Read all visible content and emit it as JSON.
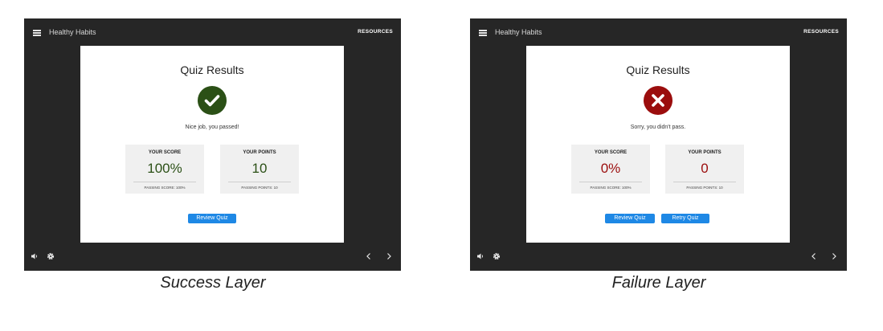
{
  "colors": {
    "pass_green": "#2b5016",
    "fail_red": "#9b0d0d",
    "button_blue": "#1e88e5",
    "player_bg": "#262626"
  },
  "success_panel": {
    "course_title": "Healthy Habits",
    "resources_label": "RESOURCES",
    "quiz_title": "Quiz Results",
    "result_icon": "check-circle-icon",
    "message": "Nice job, you passed!",
    "score_label": "YOUR SCORE",
    "score_value": "100%",
    "passing_score": "PASSING SCORE: 100%",
    "points_label": "YOUR POINTS",
    "points_value": "10",
    "passing_points": "PASSING POINTS: 10",
    "review_button": "Review Quiz",
    "caption": "Success Layer"
  },
  "failure_panel": {
    "course_title": "Healthy Habits",
    "resources_label": "RESOURCES",
    "quiz_title": "Quiz Results",
    "result_icon": "x-circle-icon",
    "message": "Sorry, you didn't pass.",
    "score_label": "YOUR SCORE",
    "score_value": "0%",
    "passing_score": "PASSING SCORE: 100%",
    "points_label": "YOUR POINTS",
    "points_value": "0",
    "passing_points": "PASSING POINTS: 10",
    "review_button": "Review Quiz",
    "retry_button": "Retry Quiz",
    "caption": "Failure Layer"
  }
}
